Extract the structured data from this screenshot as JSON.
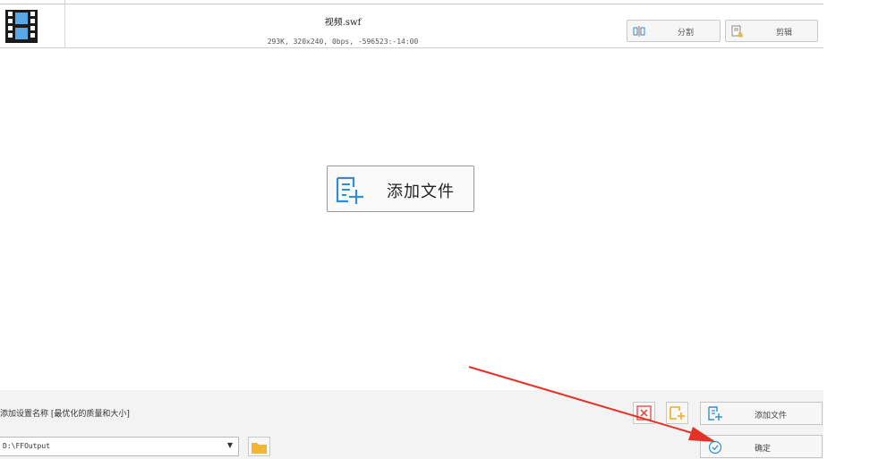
{
  "file_list": {
    "rows": [
      {
        "name": "视频.swf",
        "info": "293K, 320x240, 0bps, -596523:-14:00",
        "split_label": "分割",
        "cut_label": "剪辑"
      }
    ]
  },
  "main": {
    "add_file_label": "添加文件"
  },
  "bottom": {
    "preset_label": "添加设置名称 [最优化的质量和大小]",
    "output_folder": "D:\\FFOutput",
    "add_file_label": "添加文件",
    "confirm_label": "确定"
  },
  "colors": {
    "accent_blue": "#2f8fd0",
    "folder_yellow": "#f2b632",
    "clear_red": "#e0534a",
    "annotation_red": "#e53226"
  },
  "icons": {
    "thumbnail": "film-strip-icon",
    "split": "split-icon",
    "cut": "scissors-doc-icon",
    "add_file": "add-document-icon",
    "clear": "clear-list-icon",
    "add_folder": "add-folder-icon",
    "confirm": "check-circle-icon",
    "browse": "folder-icon",
    "dropdown": "chevron-down-icon"
  }
}
